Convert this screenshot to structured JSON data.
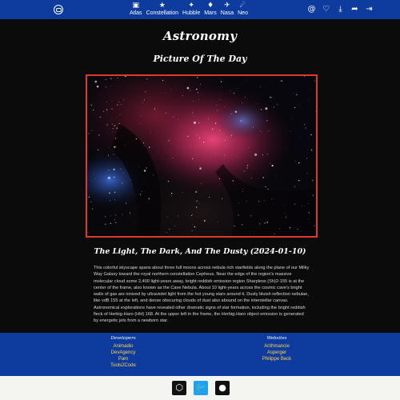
{
  "nav": {
    "items": [
      {
        "label": "Atlas",
        "icon": "atlas-icon"
      },
      {
        "label": "Constellation",
        "icon": "constellation-icon"
      },
      {
        "label": "Hubble",
        "icon": "hubble-icon"
      },
      {
        "label": "Mars",
        "icon": "mars-icon"
      },
      {
        "label": "Nasa",
        "icon": "nasa-icon"
      },
      {
        "label": "Neo",
        "icon": "neo-icon"
      }
    ],
    "right_icons": [
      "at-icon",
      "heart-icon",
      "download-icon",
      "share-icon",
      "login-icon"
    ]
  },
  "page": {
    "title": "Astronomy",
    "subtitle": "Picture Of The Day",
    "caption": "The Light, The Dark, And The Dusty (2024-01-10)",
    "explanation": "This colorful skyscape spans about three full moons across nebula rich starfields along the plane of our Milky Way Galaxy toward the royal northern constellation Cepheus. Near the edge of the region's massive molecular cloud some 2,400 light-years away, bright reddish emission region Sharpless (Sh)2-155 is at the center of the frame, also known as the Cave Nebula. About 10 light-years across the cosmic cave's bright walls of gas are ionized by ultraviolet light from the hot young stars around it. Dusty bluish reflection nebulae, like vdB 155 at the left, and dense obscuring clouds of dust also abound on the interstellar canvas. Astronomical explorations have revealed other dramatic signs of star formation, including the bright reddish fleck of Herbig-Haro (HH) 168. At the upper left in the frame, the Herbig-Haro object emission is generated by energetic jets from a newborn star."
  },
  "footer": {
    "developers_heading": "Developers",
    "developers": [
      "Animadio",
      "DevAgency",
      "Pam",
      "Tools2Code"
    ],
    "websites_heading": "Websites",
    "websites": [
      "Arithmancie",
      "Asperger",
      "Philippe Beck"
    ]
  },
  "social": [
    "codepen-icon",
    "twitter-icon",
    "github-icon"
  ],
  "colors": {
    "nav_bg": "#0d3b9e",
    "accent_red": "#e0382a",
    "link_yellow": "#ffd34d"
  }
}
